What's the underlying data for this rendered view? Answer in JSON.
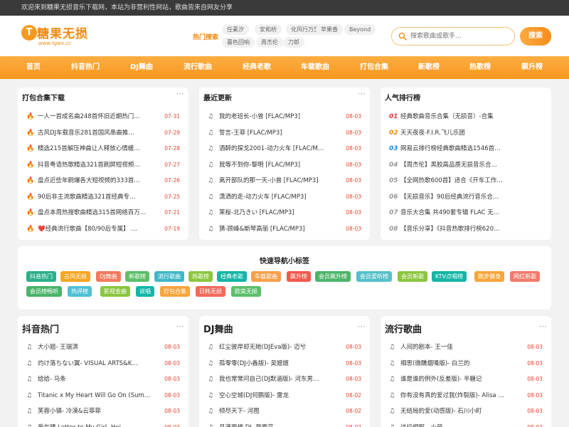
{
  "topbar": {
    "text": "欢迎来到糖果无损音乐下载网，本站为非营利性网站，歌曲皆来自网友分享"
  },
  "logo": {
    "mark": "T",
    "name": "糖果无损",
    "url": "www.tgwx.cc"
  },
  "hot": {
    "label": "热门搜索",
    "tags": [
      "任素汐",
      "安和桥",
      "化风行万里",
      "苹果香",
      "Beyond",
      "暮色回响",
      "周杰伦",
      "刀郎"
    ]
  },
  "search": {
    "placeholder": "搜索歌曲或歌手...",
    "button": "搜索",
    "icon": "search-icon"
  },
  "nav": [
    "首页",
    "抖音热门",
    "DJ舞曲",
    "流行歌曲",
    "经典老歌",
    "车载歌曲",
    "打包合集",
    "新歌榜",
    "热歌榜",
    "飙升榜"
  ],
  "colors": {
    "accent": "#f8961f",
    "date": "#f0422d",
    "rank1": "#e53935",
    "rank2": "#f08a12",
    "rank3": "#1e88e5"
  },
  "packs": {
    "title": "打包合集下载",
    "more": "···",
    "icon": "fire-icon",
    "items": [
      {
        "title": "一人一首成名曲248首怀旧近期热门…",
        "date": "07-31"
      },
      {
        "title": "古风DJ车载音乐281首国风串曲推…",
        "date": "07-29"
      },
      {
        "title": "精选215首解压神曲让人释放心情缓…",
        "date": "07-28"
      },
      {
        "title": "抖音粤语热歌精选321首刷屏短视频…",
        "date": "07-27"
      },
      {
        "title": "盘点近些年刷爆各大短视频的333首…",
        "date": "07-26"
      },
      {
        "title": "90后非主流歌曲精选321首经典专…",
        "date": "07-25"
      },
      {
        "title": "盘点本周热搜歌曲精选315首网络百万…",
        "date": "07-21"
      },
      {
        "title": "❤️经典流行歌曲【80/90后专属】 …",
        "date": "07-19"
      }
    ]
  },
  "latest": {
    "title": "最近更新",
    "more": "···",
    "icon": "music-note-icon",
    "items": [
      {
        "title": "我的老班长-小曾 [FLAC/MP3]",
        "date": "08-03"
      },
      {
        "title": "誓言-王菲 [FLAC/MP3]",
        "date": "08-03"
      },
      {
        "title": "酒醉的探戈2001-动力火车 [FLAC/M…",
        "date": "08-03"
      },
      {
        "title": "我等不到你-黎明 [FLAC/MP3]",
        "date": "08-03"
      },
      {
        "title": "离开部队的那一天-小曾 [FLAC/MP3]",
        "date": "08-03"
      },
      {
        "title": "潇洒的走-动力火车 [FLAC/MP3]",
        "date": "08-03"
      },
      {
        "title": "茉桜-北乃きい [FLAC/MP3]",
        "date": "08-03"
      },
      {
        "title": "猜-顾峰&斯琴高丽 [FLAC/MP3]",
        "date": "08-03"
      }
    ]
  },
  "ranking": {
    "title": "人气排行榜",
    "items": [
      {
        "rank": "01",
        "title": "经典歌曲音乐合集（无损音）-合集"
      },
      {
        "rank": "02",
        "title": "天天夜夜-F.I.R.飞儿乐团"
      },
      {
        "rank": "03",
        "title": "网易云排行榜经典歌曲精选1546首…"
      },
      {
        "rank": "04",
        "title": "【周杰伦】黑胶高品质无损音乐合…"
      },
      {
        "rank": "05",
        "title": "【全网热歌600首】适合《开车工作…"
      },
      {
        "rank": "06",
        "title": "【无损音乐】90后经典流行音乐合…"
      },
      {
        "rank": "07",
        "title": "音乐大合集 共490套专辑 FLAC 无…"
      },
      {
        "rank": "08",
        "title": "【音乐分享】《抖音热歌排行榜620…"
      }
    ]
  },
  "quick_nav": {
    "title": "快速导航小标签",
    "tags": [
      {
        "label": "抖音热门",
        "color": "#2cb08a"
      },
      {
        "label": "古风无损",
        "color": "#f6a623"
      },
      {
        "label": "DJ舞曲",
        "color": "#f4795c"
      },
      {
        "label": "新歌榜",
        "color": "#5bbf6a"
      },
      {
        "label": "流行歌曲",
        "color": "#40b7c8"
      },
      {
        "label": "热歌榜",
        "color": "#8cc63f"
      },
      {
        "label": "经典老歌",
        "color": "#13b5a5"
      },
      {
        "label": "车载歌曲",
        "color": "#f7a04a"
      },
      {
        "label": "飙升榜",
        "color": "#f05a4c"
      },
      {
        "label": "会员飙升榜",
        "color": "#4cb56a"
      },
      {
        "label": "会员爱听榜",
        "color": "#56c0c9"
      },
      {
        "label": "会员新歌",
        "color": "#8bc63f"
      },
      {
        "label": "KTV点唱榜",
        "color": "#14b5a7"
      },
      {
        "label": "跑步健身",
        "color": "#f7a53c"
      },
      {
        "label": "网红新歌",
        "color": "#f27b6b"
      },
      {
        "label": "会员榜畅听",
        "color": "#4bb36a"
      },
      {
        "label": "热评榜",
        "color": "#4fc0d4"
      },
      {
        "label": "影视金曲",
        "color": "#8bc63f"
      },
      {
        "label": "说唱",
        "color": "#12b7a9"
      },
      {
        "label": "打包合集",
        "color": "#f7a53c"
      },
      {
        "label": "日韩无损",
        "color": "#f26a5a"
      },
      {
        "label": "欧美无损",
        "color": "#5bbf6a"
      }
    ]
  },
  "douyin": {
    "title": "抖音热门",
    "more": "···",
    "items": [
      {
        "title": "大小姐- 王瑞淇",
        "date": "08-03"
      },
      {
        "title": "灼け落ちない翼- VISUAL ARTS&K…",
        "date": "08-03"
      },
      {
        "title": "给给- 马条",
        "date": "08-03"
      },
      {
        "title": "Titanic x My Heart Will Go On (Sum…",
        "date": "08-03"
      },
      {
        "title": "芙蓉小镇- 冷漠&云菲菲",
        "date": "08-03"
      },
      {
        "title": "爱在晴 Letter to My Girl- Hei…",
        "date": "08-03"
      }
    ]
  },
  "dj": {
    "title": "DJ舞曲",
    "more": "···",
    "items": [
      {
        "title": "红尘彼岸却无她(DJEva版)- 迈兮",
        "date": "08-03"
      },
      {
        "title": "孤零零(DJ小鑫版)- 吴嬗嬗",
        "date": "08-03"
      },
      {
        "title": "我也常常问自己(DJ默涵版)- 河东男…",
        "date": "08-03"
      },
      {
        "title": "空心空城(DJ何鹏版)- 雷龙",
        "date": "08-02"
      },
      {
        "title": "倾尽天下- 河图",
        "date": "08-02"
      },
      {
        "title": "月满西楼 DJ- 夏雪花",
        "date": "08-02"
      }
    ]
  },
  "pop": {
    "title": "流行歌曲",
    "more": "···",
    "items": [
      {
        "title": "人间的剧本- 王一佳",
        "date": "08-03"
      },
      {
        "title": "相思(微醺烟嗓版)- 白兰的",
        "date": "08-03"
      },
      {
        "title": "谁是谁的例外(反差版)- 半糖记",
        "date": "08-03"
      },
      {
        "title": "你有没有真的爱过我(炸裂版)- Alisa …",
        "date": "08-03"
      },
      {
        "title": "无结局的爱(动感版)- 石川小町",
        "date": "08-03"
      },
      {
        "title": "这行相照 - 小莹",
        "date": "08-03"
      }
    ]
  }
}
